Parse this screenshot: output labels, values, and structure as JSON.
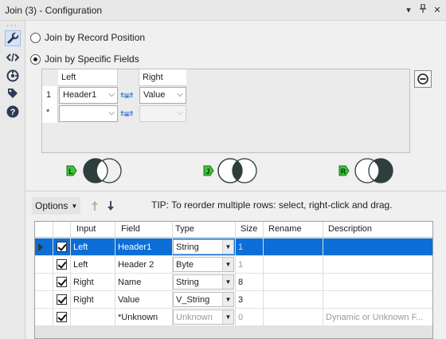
{
  "window": {
    "title": "Join (3) - Configuration",
    "controls": [
      "chevron-down-icon",
      "pin-icon",
      "close-icon"
    ]
  },
  "rail": {
    "icons": [
      "wrench-icon",
      "code-icon",
      "target-icon",
      "tag-icon",
      "help-icon"
    ],
    "active": "wrench-icon"
  },
  "join_mode": {
    "options": [
      {
        "label": "Join by Record Position",
        "selected": false
      },
      {
        "label": "Join by Specific Fields",
        "selected": true
      }
    ]
  },
  "join_fields": {
    "headers": {
      "left": "Left",
      "right": "Right"
    },
    "rows": [
      {
        "num": "1",
        "left": "Header1",
        "right": "Value"
      },
      {
        "num": "*",
        "left": "",
        "right": ""
      }
    ]
  },
  "venn": {
    "left_badge": "L",
    "join_badge": "J",
    "right_badge": "R"
  },
  "toolbar": {
    "options_label": "Options",
    "tip": "TIP: To reorder multiple rows: select, right-click and drag."
  },
  "table": {
    "columns": [
      "Input",
      "Field",
      "Type",
      "Size",
      "Rename",
      "Description"
    ],
    "rows": [
      {
        "input": "Left",
        "field": "Header1",
        "type": "String",
        "size": "1",
        "rename": "",
        "description": "",
        "selected": true,
        "checked": true
      },
      {
        "input": "Left",
        "field": "Header 2",
        "type": "Byte",
        "size": "1",
        "rename": "",
        "description": "",
        "selected": false,
        "checked": true
      },
      {
        "input": "Right",
        "field": "Name",
        "type": "String",
        "size": "8",
        "rename": "",
        "description": "",
        "selected": false,
        "checked": true
      },
      {
        "input": "Right",
        "field": "Value",
        "type": "V_String",
        "size": "3",
        "rename": "",
        "description": "",
        "selected": false,
        "checked": true
      },
      {
        "input": "",
        "field": "*Unknown",
        "type": "Unknown",
        "size": "0",
        "rename": "",
        "description": "Dynamic or Unknown F...",
        "selected": false,
        "checked": true
      }
    ]
  },
  "colors": {
    "selection": "#0c6ed6",
    "venn_dark": "#2e3e3d",
    "badge_green": "#3fc43c"
  }
}
